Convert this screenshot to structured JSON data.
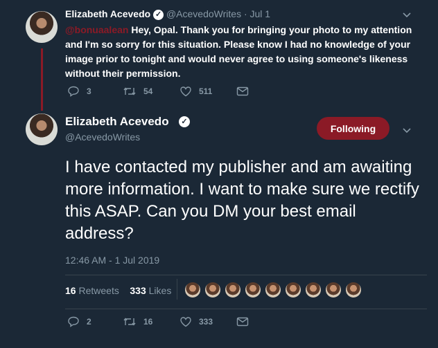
{
  "reply": {
    "name": "Elizabeth Acevedo",
    "handle": "@AcevedoWrites",
    "date": "· Jul 1",
    "mention": "@bonuaalean",
    "text": " Hey, Opal. Thank you for bringing your photo to my attention and I'm so sorry for this situation. Please know I had no knowledge of your image prior to tonight and would never agree to using someone's likeness without their permission.",
    "replies": "3",
    "retweets": "54",
    "likes": "511"
  },
  "main": {
    "name": "Elizabeth Acevedo",
    "handle": "@AcevedoWrites",
    "follow_label": "Following",
    "text": "I have contacted my publisher and am awaiting more information. I want to make sure we rectify this ASAP. Can you DM your best email address?",
    "timestamp": "12:46 AM - 1 Jul 2019",
    "retweet_count": "16",
    "retweets_label": "Retweets",
    "like_count": "333",
    "likes_label": "Likes",
    "likers_count": 9,
    "replies": "2",
    "retweets": "16",
    "likes": "333"
  },
  "colors": {
    "background": "#1b2836",
    "accent": "#8b1a26",
    "muted": "#8899a6"
  }
}
